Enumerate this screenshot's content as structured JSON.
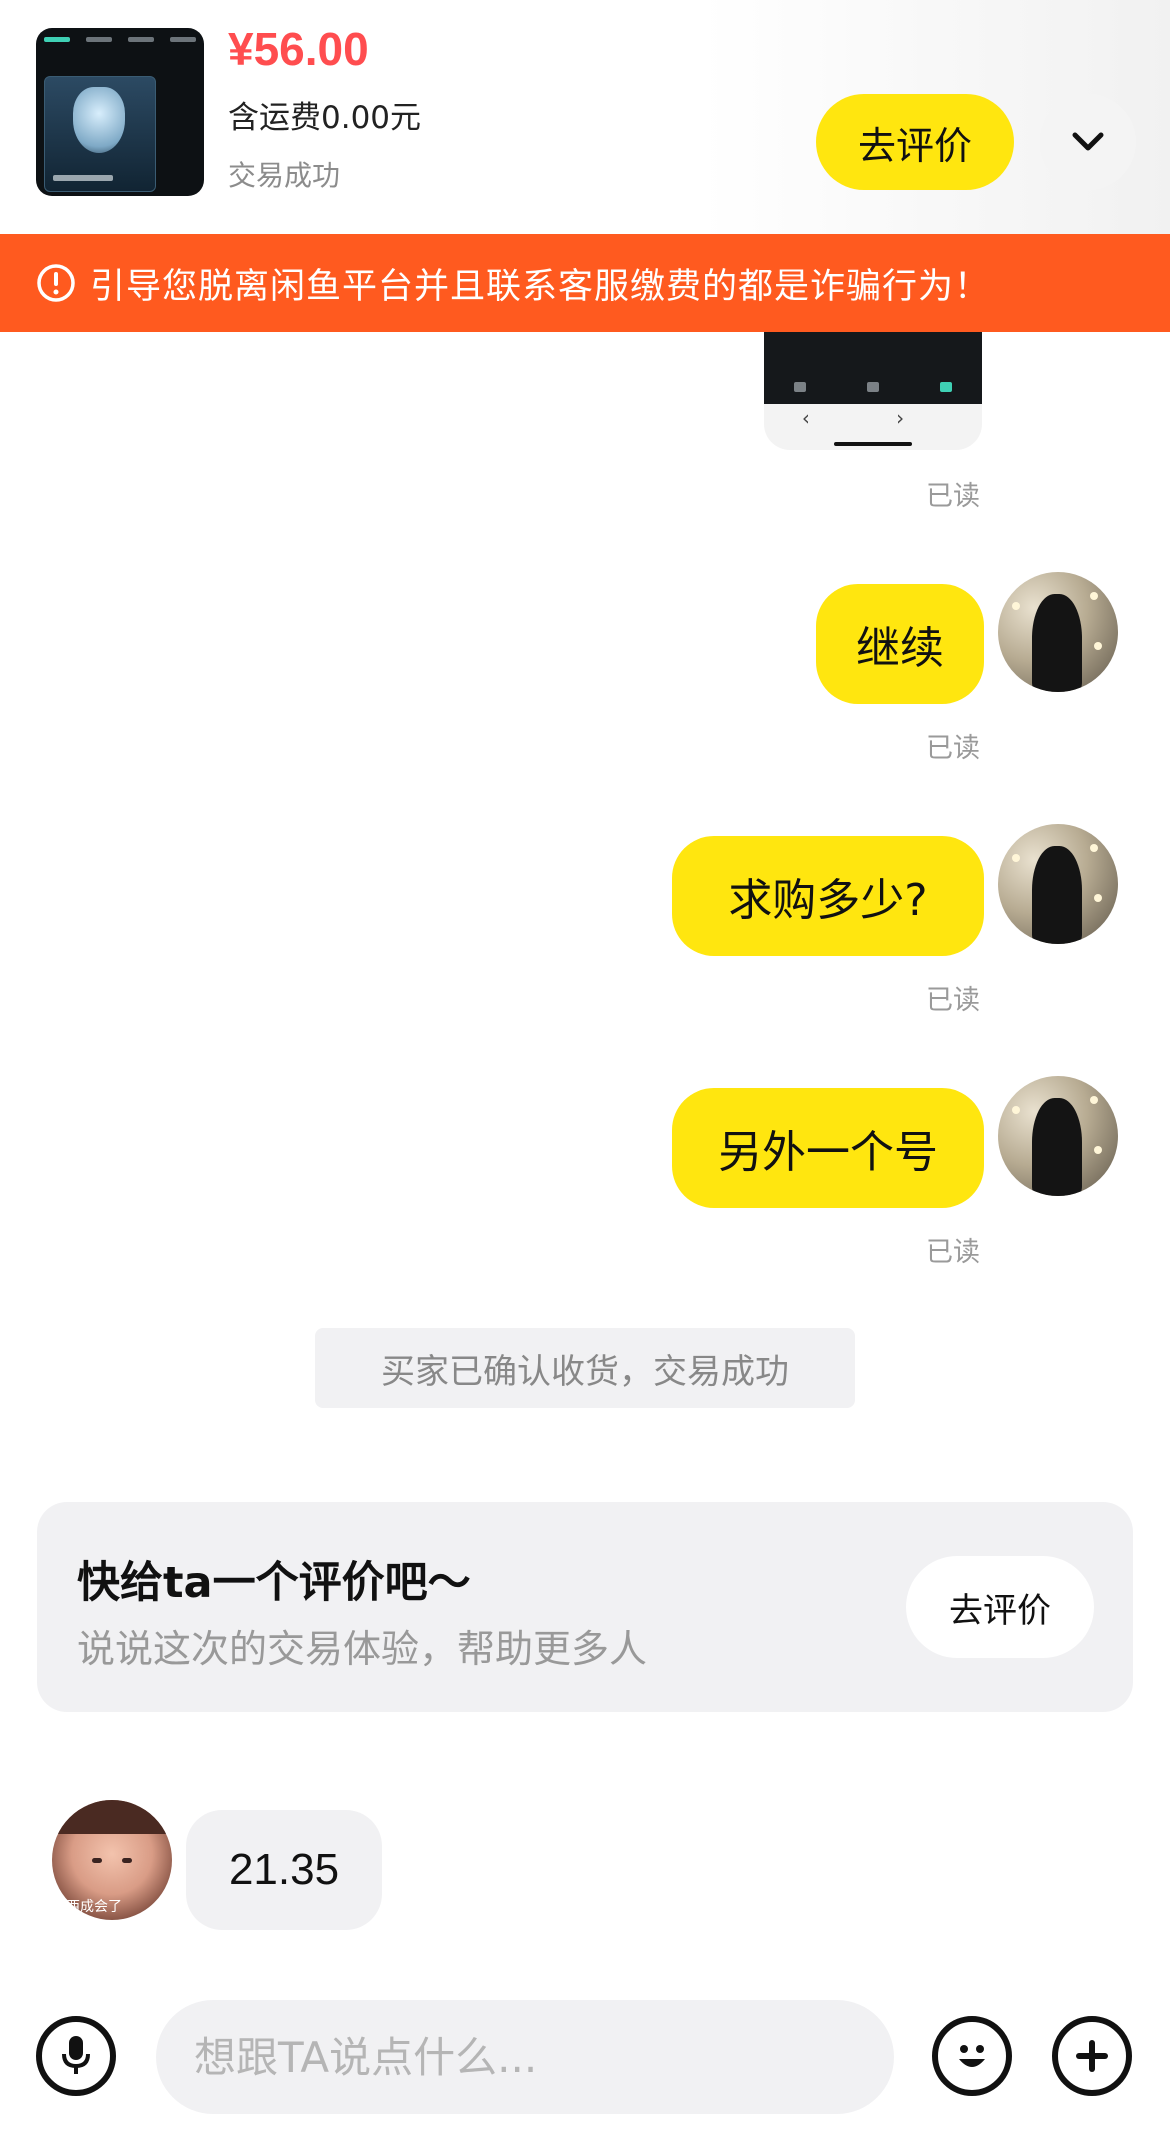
{
  "product": {
    "price": "¥56.00",
    "shipping": "含运费0.00元",
    "status": "交易成功",
    "review_button": "去评价"
  },
  "warning": {
    "text": "引导您脱离闲鱼平台并且联系客服缴费的都是诈骗行为！"
  },
  "messages": [
    {
      "side": "right",
      "text": "继续",
      "read": "已读"
    },
    {
      "side": "right",
      "text": "求购多少?",
      "read": "已读"
    },
    {
      "side": "right",
      "text": "另外一个号",
      "read": "已读"
    }
  ],
  "first_read": "已读",
  "system_notice": "买家已确认收货，交易成功",
  "review_card": {
    "title": "快给ta一个评价吧～",
    "subtitle": "说说这次的交易体验，帮助更多人",
    "button": "去评价"
  },
  "incoming": {
    "text": "21.35",
    "avatar_caption": "西成会了"
  },
  "input": {
    "placeholder": "想跟TA说点什么..."
  },
  "colors": {
    "accent_yellow": "#ffe60f",
    "price_red": "#ff4d4f",
    "warning_orange": "#ff5a1f"
  },
  "icons": [
    "warning-icon",
    "chevron-down-icon",
    "microphone-icon",
    "emoji-icon",
    "plus-icon"
  ]
}
